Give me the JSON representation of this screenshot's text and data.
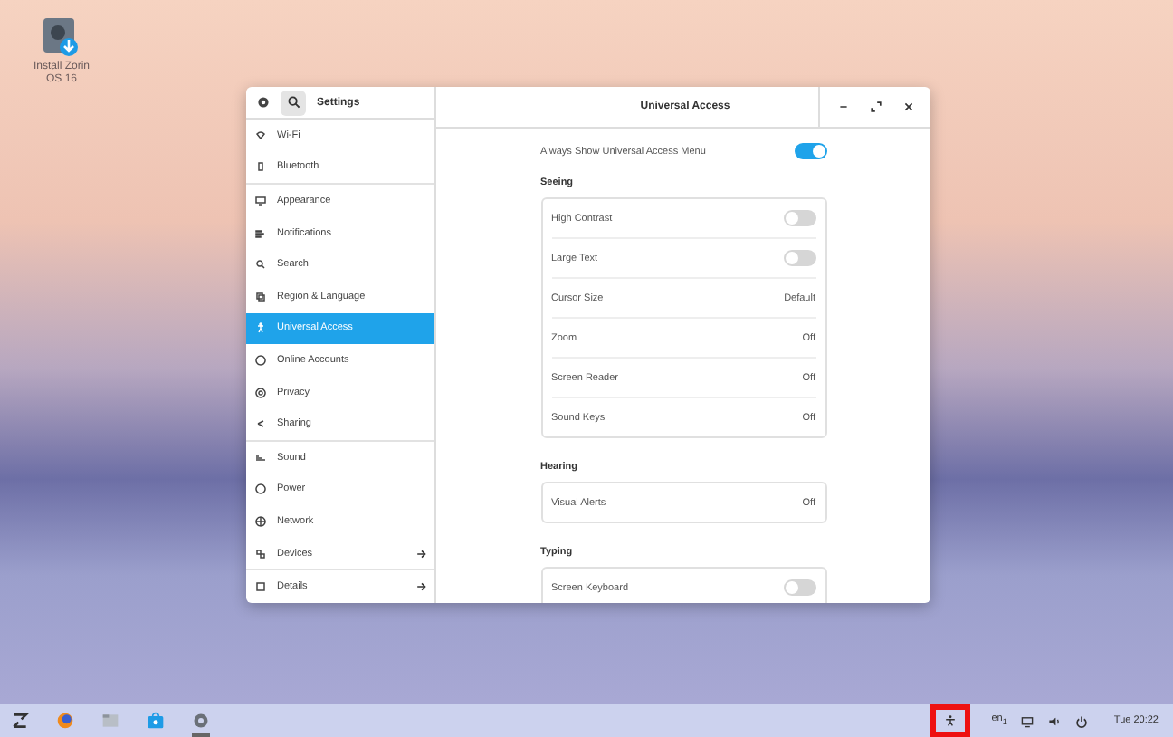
{
  "desktop_icon": {
    "label": "Install Zorin OS 16"
  },
  "window": {
    "sidebar_title": "Settings",
    "title": "Universal Access"
  },
  "sidebar": {
    "groups": [
      [
        {
          "label": "Wi-Fi",
          "selected": false,
          "has_arrow": false
        },
        {
          "label": "Bluetooth",
          "selected": false,
          "has_arrow": false
        }
      ],
      [
        {
          "label": "Appearance",
          "selected": false,
          "has_arrow": false
        },
        {
          "label": "Notifications",
          "selected": false,
          "has_arrow": false
        },
        {
          "label": "Search",
          "selected": false,
          "has_arrow": false
        },
        {
          "label": "Region & Language",
          "selected": false,
          "has_arrow": false
        },
        {
          "label": "Universal Access",
          "selected": true,
          "has_arrow": false
        },
        {
          "label": "Online Accounts",
          "selected": false,
          "has_arrow": false
        },
        {
          "label": "Privacy",
          "selected": false,
          "has_arrow": false
        },
        {
          "label": "Sharing",
          "selected": false,
          "has_arrow": false
        }
      ],
      [
        {
          "label": "Sound",
          "selected": false,
          "has_arrow": false
        },
        {
          "label": "Power",
          "selected": false,
          "has_arrow": false
        },
        {
          "label": "Network",
          "selected": false,
          "has_arrow": false
        },
        {
          "label": "Devices",
          "selected": false,
          "has_arrow": true
        }
      ],
      [
        {
          "label": "Details",
          "selected": false,
          "has_arrow": true
        }
      ]
    ]
  },
  "content": {
    "always_show": {
      "label": "Always Show Universal Access Menu",
      "on": true
    },
    "sections": [
      {
        "heading": "Seeing",
        "rows": [
          {
            "kind": "switch",
            "label": "High Contrast",
            "on": false
          },
          {
            "kind": "switch",
            "label": "Large Text",
            "on": false
          },
          {
            "kind": "value",
            "label": "Cursor Size",
            "value": "Default"
          },
          {
            "kind": "value",
            "label": "Zoom",
            "value": "Off"
          },
          {
            "kind": "value",
            "label": "Screen Reader",
            "value": "Off"
          },
          {
            "kind": "value",
            "label": "Sound Keys",
            "value": "Off"
          }
        ]
      },
      {
        "heading": "Hearing",
        "rows": [
          {
            "kind": "value",
            "label": "Visual Alerts",
            "value": "Off"
          }
        ]
      },
      {
        "heading": "Typing",
        "rows": [
          {
            "kind": "switch",
            "label": "Screen Keyboard",
            "on": false
          }
        ]
      }
    ]
  },
  "taskbar": {
    "accessibility_highlighted": true,
    "keyboard_layout": "en$_{1}$",
    "clock": "Tue 20:22"
  }
}
